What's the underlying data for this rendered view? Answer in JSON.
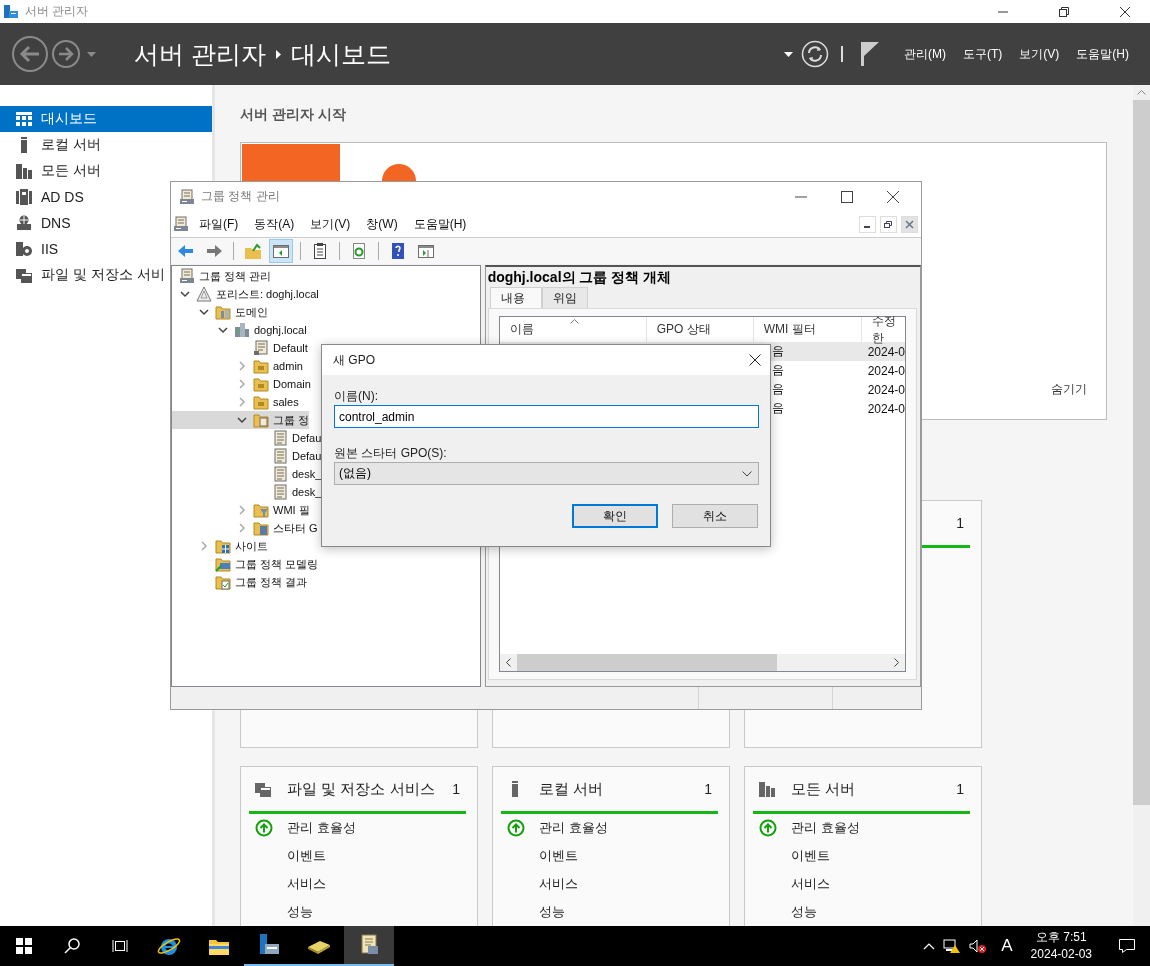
{
  "app_window": {
    "title": "서버 관리자"
  },
  "header": {
    "breadcrumb": [
      "서버 관리자",
      "대시보드"
    ],
    "menus": [
      "관리(M)",
      "도구(T)",
      "보기(V)",
      "도움말(H)"
    ]
  },
  "sidebar": {
    "items": [
      {
        "label": "대시보드",
        "kind": "dashboard",
        "selected": true
      },
      {
        "label": "로컬 서버",
        "kind": "local",
        "selected": false
      },
      {
        "label": "모든 서버",
        "kind": "all",
        "selected": false
      },
      {
        "label": "AD DS",
        "kind": "adds",
        "selected": false
      },
      {
        "label": "DNS",
        "kind": "dns",
        "selected": false
      },
      {
        "label": "IIS",
        "kind": "iis",
        "selected": false
      },
      {
        "label": "파일 및 저장소 서비",
        "kind": "files",
        "selected": false
      }
    ]
  },
  "dashboard": {
    "heading": "서버 관리자 시작",
    "welcome": {
      "hide": "숨기기"
    },
    "top_cards": [
      {
        "kind": "covered"
      },
      {
        "kind": "covered"
      },
      {
        "kind": "count",
        "count": "1"
      }
    ],
    "cards": [
      {
        "title": "파일 및 저장소 서비스",
        "kind": "files",
        "count": "1",
        "items": [
          {
            "label": "관리 효율성",
            "status_icon": true
          },
          {
            "label": "이벤트",
            "status_icon": false
          },
          {
            "label": "서비스",
            "status_icon": false
          },
          {
            "label": "성능",
            "status_icon": false
          }
        ]
      },
      {
        "title": "로컬 서버",
        "kind": "local",
        "count": "1",
        "items": [
          {
            "label": "관리 효율성",
            "status_icon": true
          },
          {
            "label": "이벤트",
            "status_icon": false
          },
          {
            "label": "서비스",
            "status_icon": false
          },
          {
            "label": "성능",
            "status_icon": false
          }
        ]
      },
      {
        "title": "모든 서버",
        "kind": "all",
        "count": "1",
        "items": [
          {
            "label": "관리 효율성",
            "status_icon": true
          },
          {
            "label": "이벤트",
            "status_icon": false
          },
          {
            "label": "서비스",
            "status_icon": false
          },
          {
            "label": "성능",
            "status_icon": false
          }
        ]
      }
    ]
  },
  "gpmc_window": {
    "title": "그룹 정책 관리",
    "menus": [
      "파일(F)",
      "동작(A)",
      "보기(V)",
      "창(W)",
      "도움말(H)"
    ],
    "toolbar": [
      {
        "kind": "back",
        "pressed": false
      },
      {
        "kind": "forward",
        "pressed": false
      },
      {
        "kind": "separator"
      },
      {
        "kind": "up",
        "pressed": false
      },
      {
        "kind": "tree",
        "pressed": true
      },
      {
        "kind": "separator"
      },
      {
        "kind": "clipboard",
        "pressed": false
      },
      {
        "kind": "separator"
      },
      {
        "kind": "refresh",
        "pressed": false
      },
      {
        "kind": "separator"
      },
      {
        "kind": "help",
        "pressed": false
      },
      {
        "kind": "panel",
        "pressed": false
      }
    ],
    "tree": [
      {
        "label": "그룹 정책 관리",
        "kind": "console",
        "selected": false,
        "children": [
          {
            "label": "포리스트: doghj.local",
            "kind": "forest",
            "expanded": true,
            "selected": false,
            "children": [
              {
                "label": "도메인",
                "kind": "domains",
                "expanded": true,
                "selected": false,
                "children": [
                  {
                    "label": "doghj.local",
                    "kind": "domain",
                    "expanded": true,
                    "selected": false,
                    "children": [
                      {
                        "label": "Default",
                        "kind": "gpo-link",
                        "selected": false
                      },
                      {
                        "label": "admin",
                        "kind": "ou",
                        "expanded": false,
                        "selected": false
                      },
                      {
                        "label": "Domain",
                        "kind": "ou",
                        "expanded": false,
                        "selected": false
                      },
                      {
                        "label": "sales",
                        "kind": "ou",
                        "expanded": false,
                        "selected": false
                      },
                      {
                        "label": "그룹 정",
                        "kind": "gpo-folder",
                        "expanded": true,
                        "selected": true,
                        "children": [
                          {
                            "label": "Defau",
                            "kind": "gpo",
                            "selected": false
                          },
                          {
                            "label": "Defau",
                            "kind": "gpo",
                            "selected": false
                          },
                          {
                            "label": "desk_",
                            "kind": "gpo",
                            "selected": false
                          },
                          {
                            "label": "desk_",
                            "kind": "gpo",
                            "selected": false
                          }
                        ]
                      },
                      {
                        "label": "WMI 필",
                        "kind": "wmi",
                        "expanded": false,
                        "selected": false
                      },
                      {
                        "label": "스타터 G",
                        "kind": "starter",
                        "expanded": false,
                        "selected": false
                      }
                    ]
                  }
                ]
              },
              {
                "label": "사이트",
                "kind": "sites",
                "expanded": false,
                "selected": false
              },
              {
                "label": "그룹 정책 모델링",
                "kind": "modeling",
                "selected": false
              },
              {
                "label": "그룹 정책 결과",
                "kind": "results",
                "selected": false
              }
            ]
          }
        ]
      }
    ],
    "gpo_panel": {
      "title": "doghj.local의 그룹 정책 개체",
      "tabs": [
        {
          "label": "내용",
          "selected": true
        },
        {
          "label": "위임",
          "selected": false
        }
      ],
      "columns": [
        "이름",
        "GPO 상태",
        "WMI 필터",
        "수정한"
      ],
      "rows": [
        {
          "selected": true,
          "wmi_filter": "음",
          "modified": "2024-0"
        },
        {
          "selected": false,
          "wmi_filter": "음",
          "modified": "2024-0"
        },
        {
          "selected": false,
          "wmi_filter": "음",
          "modified": "2024-0"
        },
        {
          "selected": false,
          "wmi_filter": "음",
          "modified": "2024-0"
        }
      ]
    }
  },
  "dialog": {
    "title": "새 GPO",
    "name_label": "이름(N):",
    "name_value": "control_admin",
    "starter_label": "원본 스타터 GPO(S):",
    "starter_value": "(없음)",
    "buttons": [
      {
        "label": "확인",
        "default": true
      },
      {
        "label": "취소",
        "default": false
      }
    ]
  },
  "taskbar": {
    "apps": [
      {
        "kind": "ie",
        "running": false,
        "active": false
      },
      {
        "kind": "explorer",
        "running": false,
        "active": false
      },
      {
        "kind": "server-manager",
        "running": true,
        "active": false
      },
      {
        "kind": "notebook",
        "running": true,
        "active": false
      },
      {
        "kind": "gpmc",
        "running": true,
        "active": true
      }
    ],
    "input_indicator": "A",
    "time": "오후 7:51",
    "date": "2024-02-03"
  }
}
